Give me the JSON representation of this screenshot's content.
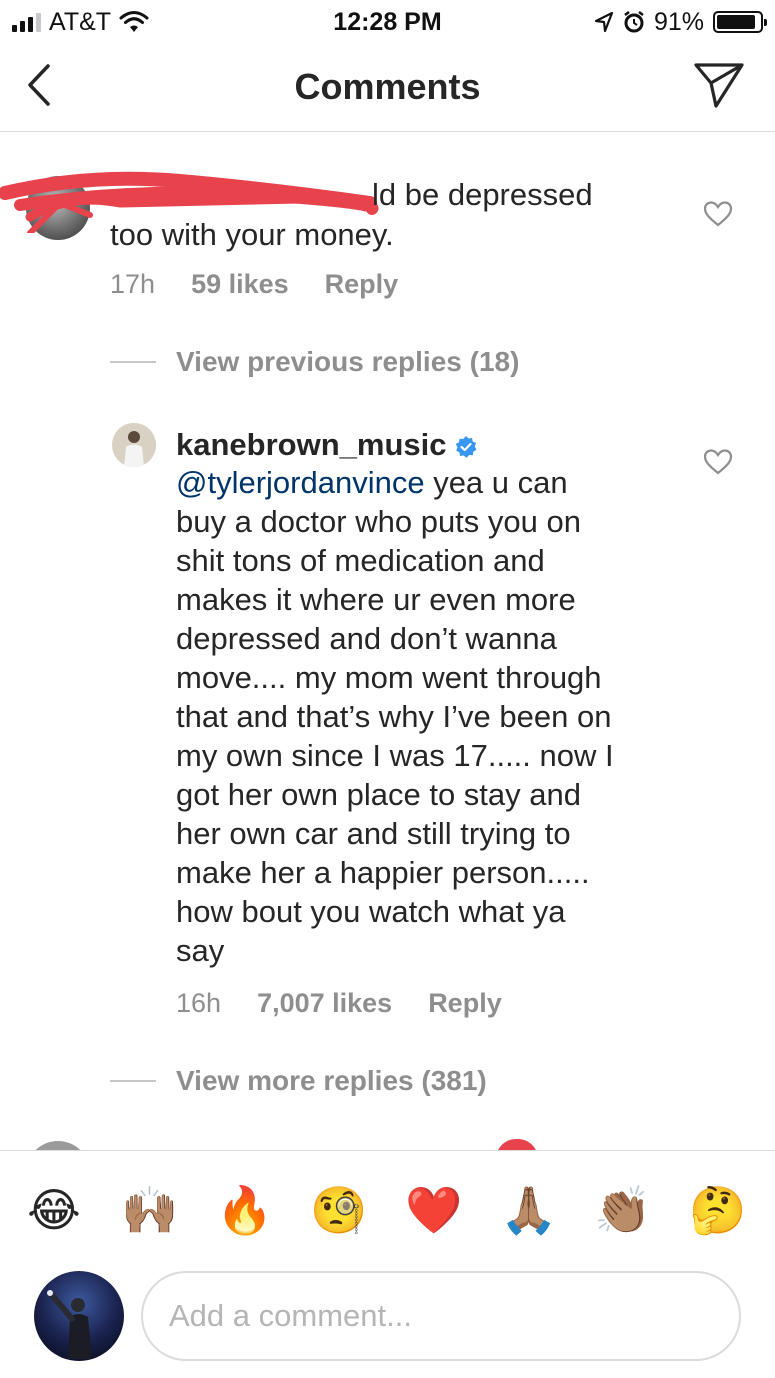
{
  "status_bar": {
    "carrier": "AT&T",
    "time": "12:28 PM",
    "battery": "91%",
    "battery_level": 0.91,
    "icons": [
      "signal-icon",
      "wifi-icon",
      "location-arrow-icon",
      "alarm-icon",
      "battery-icon"
    ]
  },
  "nav": {
    "title": "Comments",
    "back_icon": "chevron-left-icon",
    "send_icon": "paper-plane-icon"
  },
  "comments": [
    {
      "text_line1": "ld be depressed",
      "text_line2": "too with your money.",
      "time": "17h",
      "likes": "59 likes",
      "reply": "Reply",
      "username_redacted": true
    }
  ],
  "view_previous": "View previous replies (18)",
  "reply": {
    "username": "kanebrown_music",
    "verified": true,
    "mention": "@tylerjordanvince",
    "lines": [
      " yea u can",
      "buy a doctor who puts you on",
      "shit tons of medication and",
      "makes it where ur even more",
      "depressed and don’t wanna",
      "move.... my mom went through",
      "that and that’s why I’ve been on",
      "my own since I was 17..... now I",
      "got her own place to stay and",
      "her own car and still trying to",
      "make her a happier person.....",
      "how bout you watch what ya",
      "say"
    ],
    "time": "16h",
    "likes": "7,007 likes",
    "reply": "Reply"
  },
  "view_more": "View more replies (381)",
  "emoji_bar": [
    "😂",
    "🙌🏽",
    "🔥",
    "🧐",
    "❤️",
    "🙏🏽",
    "👏🏽",
    "🤔"
  ],
  "composer": {
    "placeholder": "Add a comment..."
  },
  "colors": {
    "text": "#262626",
    "secondary": "#8e8e8e",
    "mention": "#003569",
    "verified": "#3897f0",
    "redaction": "#e8424c",
    "divider": "#dbdbdb"
  }
}
